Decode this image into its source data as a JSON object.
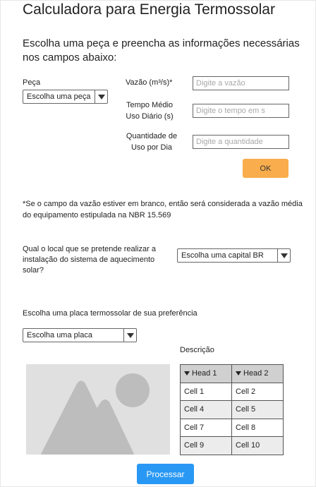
{
  "header": {
    "title": "Calculadora para Energia Termossolar",
    "subtitle": "Escolha uma peça e preencha as informações necessárias nos campos abaixo:"
  },
  "form": {
    "peca_label": "Peça",
    "peca_select": "Escolha uma peça",
    "vazao_label": "Vazão (m³/s)*",
    "vazao_placeholder": "Digite a vazão",
    "tempo_label": "Tempo Médio Uso Diário (s)",
    "tempo_placeholder": "Digite o tempo em s",
    "quantidade_label": "Quantidade de Uso por Dia",
    "quantidade_placeholder": "Digite a quantidade",
    "ok_button": "OK"
  },
  "note": "*Se o campo da vazão estiver em branco, então será considerada a vazão média do equipamento estipulada na NBR 15.569",
  "location": {
    "question": "Qual o local que se pretende realizar a instalação do sistema de aquecimento solar?",
    "select": "Escolha uma capital BR"
  },
  "placa": {
    "label": "Escolha uma placa termossolar de sua preferência",
    "select": "Escolha uma placa"
  },
  "description": {
    "label": "Descrição",
    "table": {
      "headers": [
        "Head 1",
        "Head 2"
      ],
      "rows": [
        [
          "Cell 1",
          "Cell 2"
        ],
        [
          "Cell 4",
          "Cell 5"
        ],
        [
          "Cell 7",
          "Cell 8"
        ],
        [
          "Cell 9",
          "Cell 10"
        ]
      ]
    }
  },
  "actions": {
    "process_button": "Processar"
  },
  "colors": {
    "ok_button": "#f9ad4c",
    "process_button": "#2998f4",
    "image_placeholder": "#e0e0e0",
    "image_shape": "#bdbdbd"
  },
  "icons": {
    "select_arrow": "chevron-down-icon",
    "image": "image-placeholder-icon",
    "sort": "sort-down-icon"
  }
}
